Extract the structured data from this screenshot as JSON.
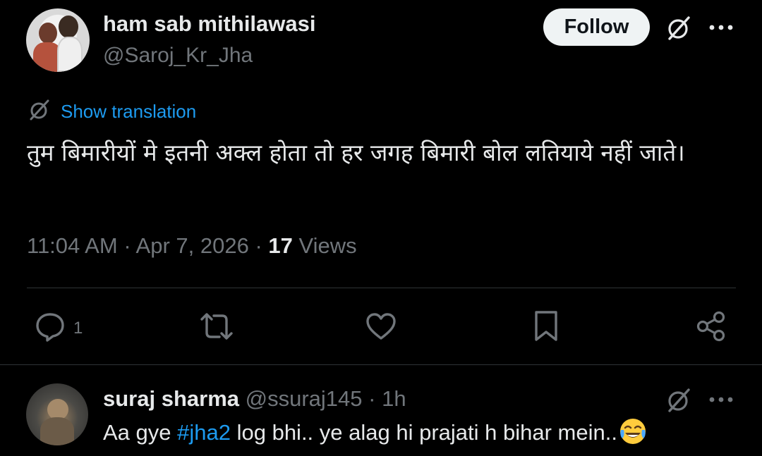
{
  "tweet": {
    "author": {
      "display_name": "ham sab mithilawasi",
      "handle": "@Saroj_Kr_Jha"
    },
    "follow_label": "Follow",
    "translate_label": "Show translation",
    "text": "तुम बिमारीयों मे इतनी अक्ल होता तो हर जगह बिमारी बोल लतियाये नहीं जाते।",
    "time": "11:04 AM",
    "date": "Apr 7, 2026",
    "views_count": "17",
    "views_label": "Views",
    "actions": {
      "reply_count": "1"
    },
    "icons": {
      "grok": "grok-icon",
      "more": "more-icon",
      "reply": "reply-icon",
      "retweet": "retweet-icon",
      "like": "like-icon",
      "bookmark": "bookmark-icon",
      "share": "share-icon"
    }
  },
  "reply": {
    "display_name": "suraj sharma",
    "handle": "@ssuraj145",
    "time": "1h",
    "text_before": "Aa gye ",
    "hashtag": "#jha2",
    "text_after": " log bhi.. ye alag hi prajati h bihar mein..",
    "emoji": "face-with-tears-of-joy"
  },
  "colors": {
    "background": "#000000",
    "text": "#e7e9ea",
    "secondary": "#71767b",
    "link": "#1d9bf0",
    "divider": "#2f3336",
    "follow_bg": "#eff3f4"
  }
}
